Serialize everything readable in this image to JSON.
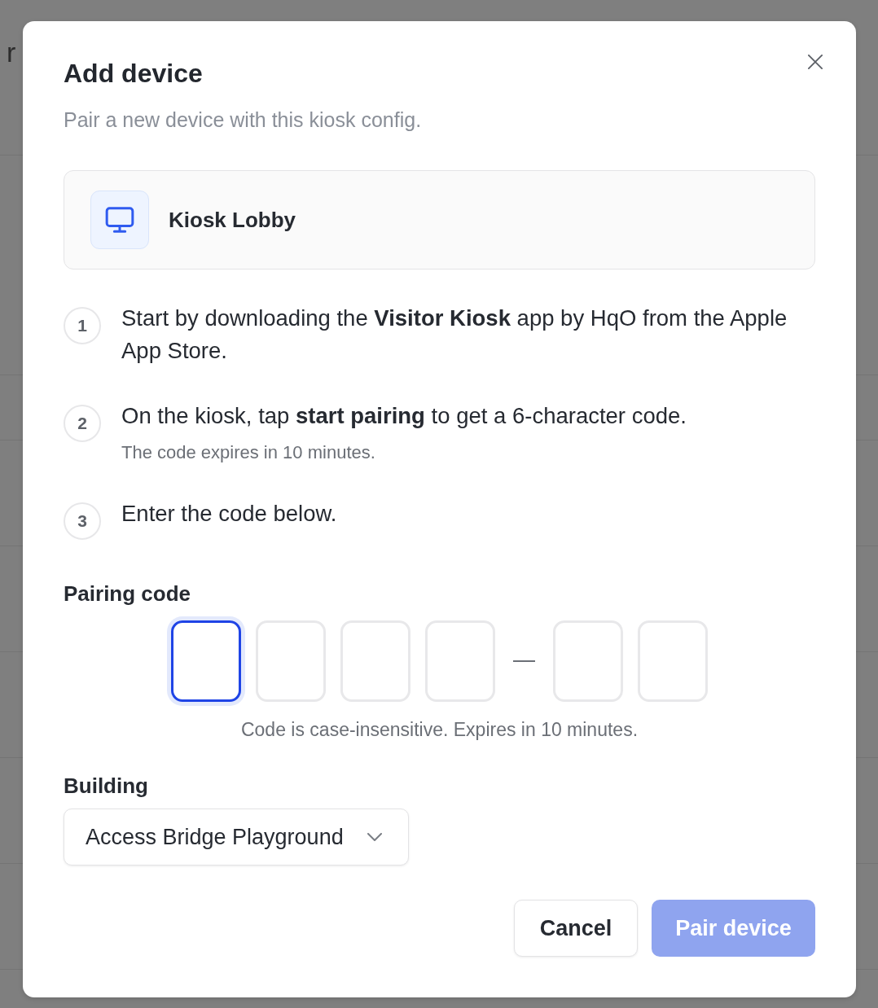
{
  "background": {
    "heading_fragment": "r"
  },
  "dialog": {
    "title": "Add device",
    "subtitle": "Pair a new device with this kiosk config."
  },
  "device": {
    "name": "Kiosk Lobby"
  },
  "steps": [
    {
      "number": "1",
      "text": "Start by downloading the **Visitor Kiosk** app by HqO from the Apple App Store."
    },
    {
      "number": "2",
      "text": "On the kiosk, tap **start pairing** to get a 6-character code.",
      "note": "The code expires in 10 minutes."
    },
    {
      "number": "3",
      "text": "Enter the code below."
    }
  ],
  "pairing_code": {
    "label": "Pairing code",
    "slots": [
      {
        "kind": "slot",
        "focused": true
      },
      {
        "kind": "slot",
        "focused": false
      },
      {
        "kind": "slot",
        "focused": false
      },
      {
        "kind": "slot",
        "focused": false
      },
      {
        "kind": "separator"
      },
      {
        "kind": "slot",
        "focused": false
      },
      {
        "kind": "slot",
        "focused": false
      }
    ],
    "hint": "Code is case-insensitive. Expires in 10 minutes."
  },
  "building": {
    "label": "Building",
    "value": "Access Bridge Playground"
  },
  "buttons": [
    {
      "label": "Cancel",
      "kind": "secondary",
      "disabled": false
    },
    {
      "label": "Pair device",
      "kind": "primary",
      "disabled": true
    }
  ]
}
